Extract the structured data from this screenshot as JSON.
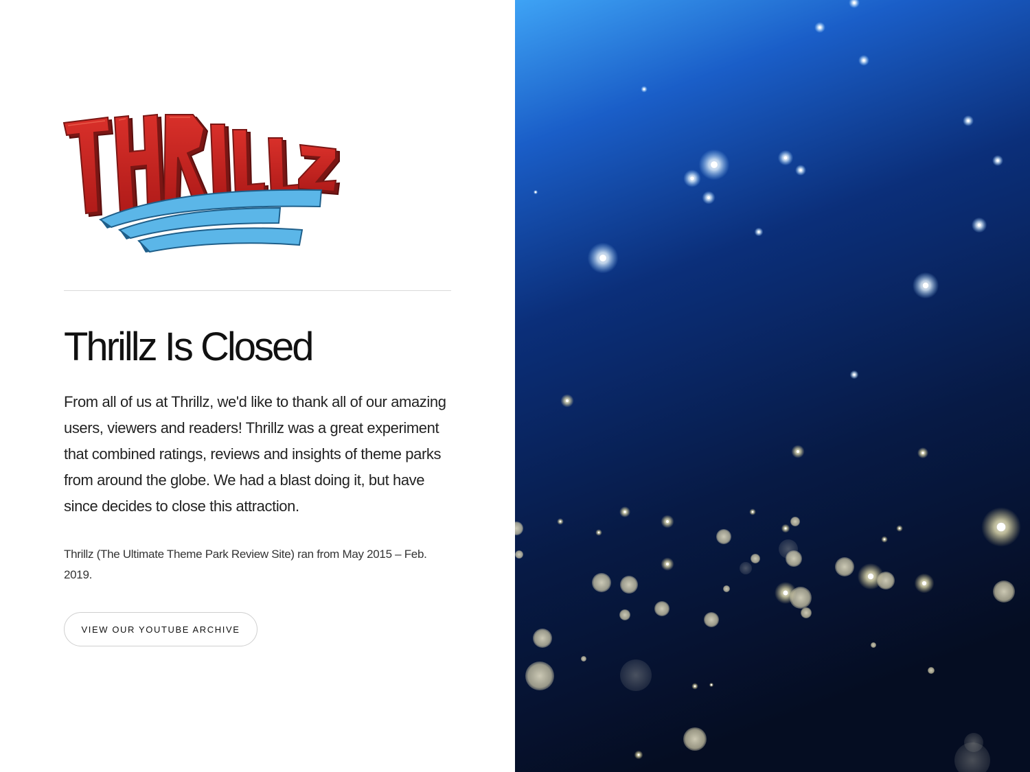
{
  "brand": {
    "logo_text": "THRILLZ",
    "colors": {
      "logo_red": "#c8201f",
      "logo_red_dark": "#7a1614",
      "logo_blue": "#5bb6e8",
      "logo_blue_dark": "#1f5f8a"
    }
  },
  "main": {
    "title": "Thrillz Is Closed",
    "message": "From all of us at Thrillz, we'd like to thank all of our amazing users, viewers and readers! Thrillz was a great experiment that combined ratings, reviews and insights of theme parks from around the globe. We had a blast doing it, but have since decides to close this attraction.",
    "run_note": "Thrillz (The Ultimate Theme Park Review Site) ran from May 2015 – Feb. 2019.",
    "archive_button_label": "VIEW OUR YOUTUBE ARCHIVE"
  },
  "background": {
    "description_colors": {
      "sky_top": "#3ea3f5",
      "sky_mid": "#0b2f7a",
      "sky_bottom": "#050d22",
      "star": "#ffffff",
      "bokeh": "#e9e3c4"
    }
  }
}
